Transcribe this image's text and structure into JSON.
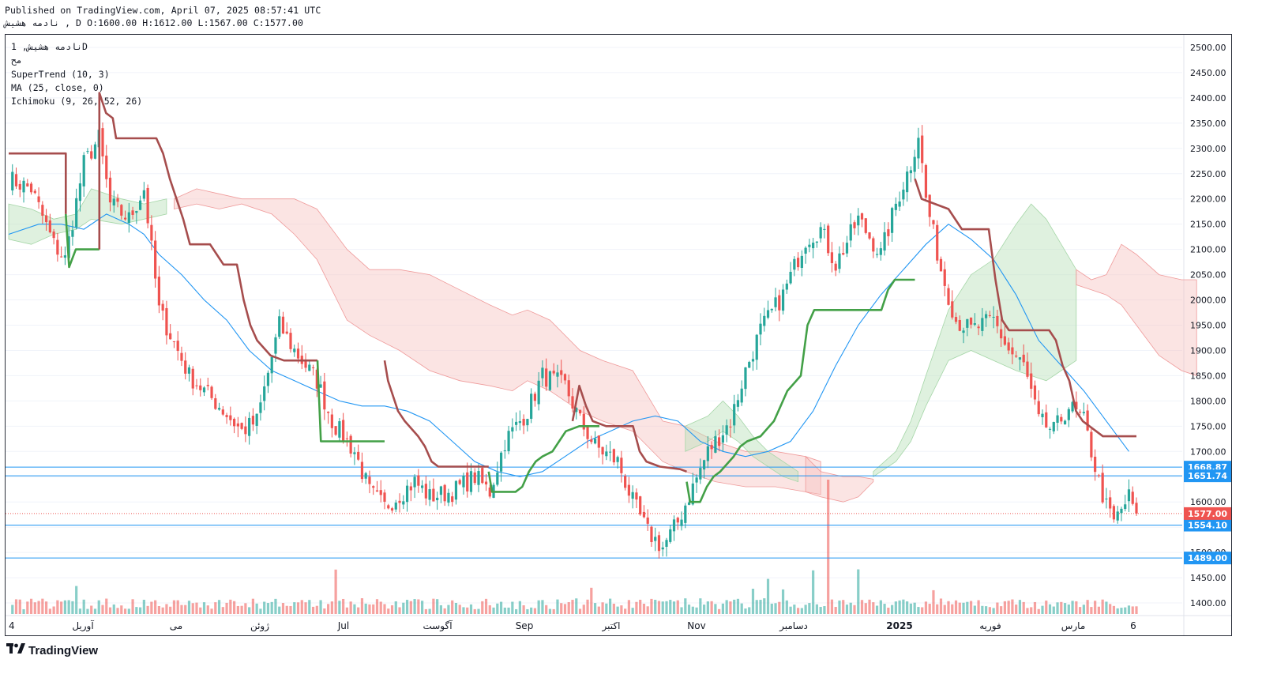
{
  "header": {
    "published": "Published on TradingView.com, April 07, 2025 08:57:41 UTC",
    "ohlc_line": "نادمه هشیش , D O:1600.00 H:1612.00 L:1567.00 C:1577.00"
  },
  "legend": {
    "symbol": "نادمه هشیش, 1D",
    "source": "مح",
    "supertrend": "SuperTrend (10, 3)",
    "ma": "MA (25, close, 0)",
    "ichimoku": "Ichimoku (9, 26, 52, 26)"
  },
  "brand": {
    "logo_icon": "tradingview-logo-icon",
    "name": "TradingView"
  },
  "colors": {
    "up": "#26a69a",
    "down": "#ef5350",
    "supertrend_up": "#43a047",
    "supertrend_down": "#a64d4d",
    "ma": "#2196f3",
    "cloud_green": "#b8e0b8",
    "cloud_red": "#f7c3c1",
    "hline": "#2196f3"
  },
  "chart_data": {
    "type": "candlestick",
    "title": "",
    "ylim": [
      1375,
      2525
    ],
    "y_ticks": [
      "2500.00",
      "2450.00",
      "2400.00",
      "2350.00",
      "2300.00",
      "2250.00",
      "2200.00",
      "2150.00",
      "2100.00",
      "2050.00",
      "2000.00",
      "1950.00",
      "1900.00",
      "1850.00",
      "1800.00",
      "1750.00",
      "1700.00",
      "1650.00",
      "1600.00",
      "1550.00",
      "1500.00",
      "1450.00",
      "1400.00"
    ],
    "x_ticks": [
      "4",
      "آوریل",
      "می",
      "ژوئن",
      "Jul",
      "آگوست",
      "Sep",
      "اکتبر",
      "Nov",
      "دسامبر",
      "2025",
      "فوریه",
      "مارس",
      "6"
    ],
    "last_close": {
      "label": "1577.00",
      "value": 1577.0
    },
    "horizontal_levels": [
      {
        "label": "1668.87",
        "value": 1668.87
      },
      {
        "label": "1651.74",
        "value": 1651.74
      },
      {
        "label": "1554.10",
        "value": 1554.1
      },
      {
        "label": "1489.00",
        "value": 1489.0
      }
    ],
    "price_path": [
      [
        0,
        2240
      ],
      [
        6,
        2220
      ],
      [
        12,
        2110
      ],
      [
        15,
        2080
      ],
      [
        20,
        2270
      ],
      [
        24,
        2320
      ],
      [
        27,
        2190
      ],
      [
        32,
        2160
      ],
      [
        36,
        2220
      ],
      [
        40,
        1980
      ],
      [
        48,
        1850
      ],
      [
        56,
        1790
      ],
      [
        62,
        1740
      ],
      [
        66,
        1760
      ],
      [
        72,
        1950
      ],
      [
        76,
        1900
      ],
      [
        82,
        1840
      ],
      [
        86,
        1760
      ],
      [
        92,
        1700
      ],
      [
        96,
        1620
      ],
      [
        100,
        1590
      ],
      [
        108,
        1640
      ],
      [
        112,
        1610
      ],
      [
        118,
        1620
      ],
      [
        124,
        1650
      ],
      [
        128,
        1620
      ],
      [
        132,
        1720
      ],
      [
        138,
        1780
      ],
      [
        142,
        1850
      ],
      [
        148,
        1830
      ],
      [
        152,
        1760
      ],
      [
        156,
        1710
      ],
      [
        162,
        1680
      ],
      [
        166,
        1600
      ],
      [
        170,
        1540
      ],
      [
        174,
        1510
      ],
      [
        178,
        1560
      ],
      [
        182,
        1630
      ],
      [
        186,
        1700
      ],
      [
        192,
        1760
      ],
      [
        196,
        1860
      ],
      [
        200,
        1940
      ],
      [
        206,
        2010
      ],
      [
        212,
        2120
      ],
      [
        216,
        2140
      ],
      [
        220,
        2070
      ],
      [
        226,
        2160
      ],
      [
        232,
        2090
      ],
      [
        236,
        2190
      ],
      [
        240,
        2270
      ],
      [
        242,
        2330
      ],
      [
        244,
        2200
      ],
      [
        248,
        2060
      ],
      [
        252,
        1960
      ],
      [
        256,
        1940
      ],
      [
        262,
        1960
      ],
      [
        266,
        1900
      ],
      [
        270,
        1870
      ],
      [
        274,
        1760
      ],
      [
        278,
        1740
      ],
      [
        282,
        1790
      ],
      [
        286,
        1760
      ],
      [
        290,
        1640
      ],
      [
        292,
        1590
      ],
      [
        294,
        1560
      ],
      [
        298,
        1610
      ],
      [
        300,
        1577
      ]
    ],
    "supertrend_down": [
      [
        0,
        2290
      ],
      [
        19,
        2290
      ],
      [
        19,
        2120
      ],
      [
        22,
        2100
      ],
      [
        23,
        2410
      ],
      [
        26,
        2360
      ],
      [
        28,
        2320
      ],
      [
        35,
        2320
      ],
      [
        38,
        2280
      ],
      [
        40,
        2240
      ],
      [
        42,
        2200
      ],
      [
        44,
        2150
      ],
      [
        48,
        2110
      ],
      [
        54,
        2110
      ],
      [
        58,
        2090
      ],
      [
        61,
        2070
      ],
      [
        66,
        2070
      ],
      [
        70,
        1980
      ],
      [
        72,
        1950
      ],
      [
        76,
        1890
      ],
      [
        80,
        1880
      ],
      [
        92,
        1880
      ],
      [
        108,
        1880
      ],
      [
        109,
        1870
      ],
      [
        110,
        1820
      ],
      [
        112,
        1790
      ],
      [
        116,
        1760
      ],
      [
        120,
        1710
      ],
      [
        124,
        1670
      ],
      [
        126,
        1660
      ],
      [
        146,
        1660
      ],
      [
        147,
        1800
      ],
      [
        149,
        1760
      ],
      [
        152,
        1720
      ],
      [
        156,
        1690
      ],
      [
        162,
        1670
      ],
      [
        174,
        1670
      ],
      [
        178,
        1660
      ],
      [
        180,
        1650
      ],
      [
        186,
        1760
      ],
      [
        190,
        1720
      ],
      [
        196,
        1680
      ],
      [
        200,
        1660
      ],
      [
        204,
        1670
      ],
      [
        208,
        1680
      ],
      [
        212,
        1660
      ],
      [
        218,
        1640
      ],
      [
        220,
        1630
      ],
      [
        226,
        1700
      ],
      [
        228,
        1730
      ],
      [
        234,
        1710
      ],
      [
        242,
        1700
      ],
      [
        248,
        1680
      ],
      [
        254,
        1660
      ],
      [
        258,
        1650
      ],
      [
        262,
        1640
      ],
      [
        266,
        1610
      ],
      [
        270,
        1600
      ],
      [
        272,
        1600
      ]
    ],
    "supertrend_up": [
      [
        0,
        2290
      ],
      [
        16,
        2290
      ],
      [
        16,
        2130
      ],
      [
        18,
        2070
      ],
      [
        19,
        2100
      ],
      [
        22,
        2100
      ]
    ],
    "ma25": [
      [
        0,
        2130
      ],
      [
        8,
        2150
      ],
      [
        14,
        2150
      ],
      [
        20,
        2140
      ],
      [
        26,
        2170
      ],
      [
        32,
        2150
      ],
      [
        36,
        2130
      ],
      [
        40,
        2090
      ],
      [
        46,
        2050
      ],
      [
        52,
        2000
      ],
      [
        58,
        1960
      ],
      [
        64,
        1900
      ],
      [
        70,
        1860
      ],
      [
        76,
        1840
      ],
      [
        82,
        1820
      ],
      [
        88,
        1800
      ],
      [
        94,
        1790
      ],
      [
        100,
        1790
      ],
      [
        106,
        1780
      ],
      [
        112,
        1760
      ],
      [
        118,
        1720
      ],
      [
        124,
        1680
      ],
      [
        130,
        1660
      ],
      [
        136,
        1650
      ],
      [
        142,
        1660
      ],
      [
        148,
        1690
      ],
      [
        154,
        1720
      ],
      [
        160,
        1740
      ],
      [
        166,
        1760
      ],
      [
        172,
        1770
      ],
      [
        178,
        1760
      ],
      [
        184,
        1720
      ],
      [
        190,
        1700
      ],
      [
        196,
        1690
      ],
      [
        202,
        1700
      ],
      [
        208,
        1720
      ],
      [
        214,
        1780
      ],
      [
        220,
        1870
      ],
      [
        226,
        1950
      ],
      [
        232,
        2010
      ],
      [
        238,
        2060
      ],
      [
        244,
        2110
      ],
      [
        250,
        2150
      ],
      [
        256,
        2120
      ],
      [
        262,
        2080
      ],
      [
        268,
        2010
      ],
      [
        274,
        1920
      ],
      [
        280,
        1870
      ],
      [
        286,
        1820
      ],
      [
        292,
        1760
      ],
      [
        298,
        1700
      ]
    ]
  }
}
